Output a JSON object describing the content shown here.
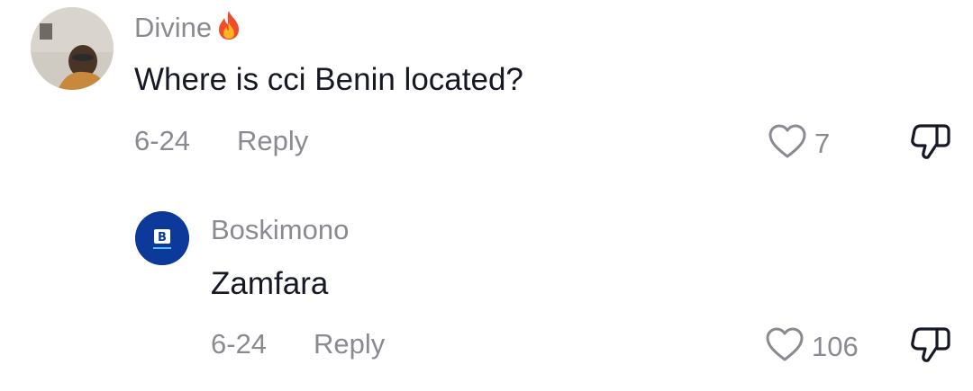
{
  "comments": [
    {
      "username": "Divine",
      "text": "Where is cci Benin located?",
      "date": "6-24",
      "reply_label": "Reply",
      "likes": "7"
    },
    {
      "username": "Boskimono",
      "text": "Zamfara",
      "date": "6-24",
      "reply_label": "Reply",
      "likes": "106",
      "avatar_letter": "B"
    }
  ],
  "icons": {
    "like": "heart-icon",
    "dislike": "thumbs-down-icon",
    "badge": "fire-icon"
  },
  "colors": {
    "text": "#161823",
    "muted": "#8a8b91",
    "avatar_brand": "#0d3a9a"
  }
}
